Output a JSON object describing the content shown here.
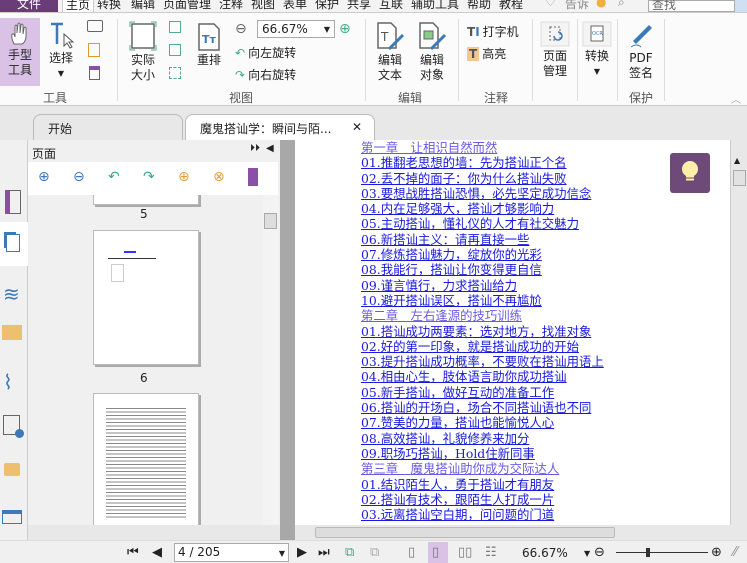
{
  "menu": {
    "file": "文件",
    "items": [
      "主页",
      "转换",
      "编辑",
      "页面管理",
      "注释",
      "视图",
      "表单",
      "保护",
      "共享",
      "互联",
      "辅助工具",
      "帮助",
      "教程"
    ],
    "tell": "告诉",
    "search_placeholder": "查找"
  },
  "ribbon": {
    "hand": "手型工具",
    "select": "选择",
    "actual_size": "实际大小",
    "reflow": "重排",
    "zoom_value": "66.67%",
    "rotate_left": "向左旋转",
    "rotate_right": "向右旋转",
    "edit_text": "编辑文本",
    "edit_object": "编辑对象",
    "typewriter": "打字机",
    "highlight": "高亮",
    "page_manage": "页面管理",
    "convert": "转换",
    "pdf_sign": "PDF签名",
    "groups": [
      "工具",
      "视图",
      "编辑",
      "注释",
      "保护"
    ]
  },
  "tabs": [
    {
      "label": "开始"
    },
    {
      "label": "魔鬼搭讪学：瞬间与陌..."
    }
  ],
  "panel": {
    "title": "页面",
    "page_labels": [
      "5",
      "6"
    ]
  },
  "toc": [
    {
      "t": "第一章　让相识自然而然",
      "ch": true
    },
    {
      "t": "01.推翻老思想的墙：先为搭讪正个名"
    },
    {
      "t": "02.丢不掉的面子：你为什么搭讪失败"
    },
    {
      "t": "03.要想战胜搭讪恐惧，必先坚定成功信念"
    },
    {
      "t": "04.内在足够强大，搭讪才够影响力"
    },
    {
      "t": "05.主动搭讪，懂礼仪的人才有社交魅力"
    },
    {
      "t": "06.新搭讪主义：请再直接一些"
    },
    {
      "t": "07.修炼搭讪魅力，绽放你的光彩"
    },
    {
      "t": "08.我能行，搭讪让你变得更自信"
    },
    {
      "t": "09.谨言慎行，力求搭讪给力"
    },
    {
      "t": "10.避开搭讪误区，搭讪不再尴尬"
    },
    {
      "t": "第二章　左右逢源的技巧训练",
      "ch": true
    },
    {
      "t": "01.搭讪成功两要素：选对地方，找准对象"
    },
    {
      "t": "02.好的第一印象，就是搭讪成功的开始"
    },
    {
      "t": "03.提升搭讪成功概率，不要败在搭讪用语上"
    },
    {
      "t": "04.相由心生，肢体语言助你成功搭讪"
    },
    {
      "t": "05.新手搭讪，做好互动的准备工作"
    },
    {
      "t": "06.搭讪的开场白，场合不同搭讪语也不同"
    },
    {
      "t": "07.赞美的力量，搭讪也能愉悦人心"
    },
    {
      "t": "08.高效搭讪，礼貌修养来加分"
    },
    {
      "t": "09.职场巧搭讪，Hold住新同事"
    },
    {
      "t": "第三章　魔鬼搭讪助你成为交际达人",
      "ch": true
    },
    {
      "t": "01.结识陌生人，勇于搭讪才有朋友"
    },
    {
      "t": "02.搭讪有技术，跟陌生人打成一片"
    },
    {
      "t": "03.远离搭讪空白期，问问题的门道"
    }
  ],
  "status": {
    "page": "4 / 205",
    "zoom": "66.67%",
    "zoom_fraction": 0.35
  },
  "colors": {
    "accent": "#6b3d78",
    "link": "#1a1adb"
  }
}
